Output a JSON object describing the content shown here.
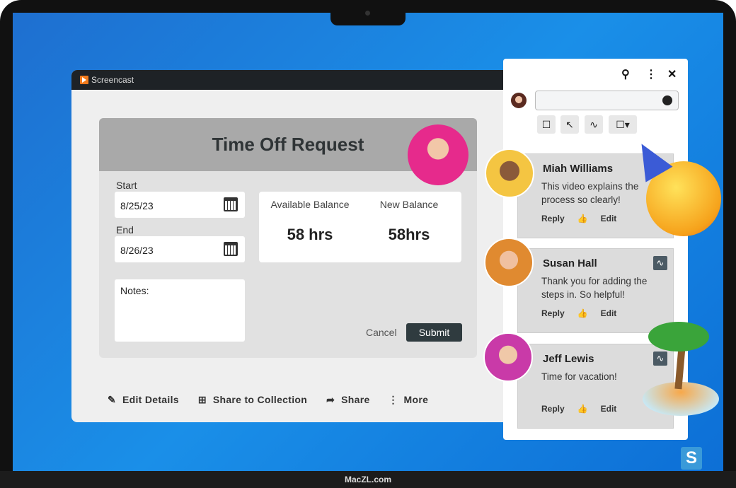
{
  "app": {
    "title": "Screencast"
  },
  "form": {
    "title": "Time Off Request",
    "start_label": "Start",
    "start_value": "8/25/23",
    "end_label": "End",
    "end_value": "8/26/23",
    "notes_label": "Notes:",
    "available_label": "Available Balance",
    "available_value": "58 hrs",
    "new_label": "New Balance",
    "new_value": "58hrs",
    "cancel": "Cancel",
    "submit": "Submit"
  },
  "actions": [
    {
      "label": "Edit Details",
      "icon": "pencil-icon"
    },
    {
      "label": "Share to Collection",
      "icon": "collection-icon"
    },
    {
      "label": "Share",
      "icon": "share-icon"
    },
    {
      "label": "More",
      "icon": "more-icon"
    }
  ],
  "comments": [
    {
      "name": "Miah Williams",
      "text": "This video explains the process so clearly!",
      "reply": "Reply",
      "edit": "Edit",
      "avatar_color": "#f4c542"
    },
    {
      "name": "Susan Hall",
      "text": "Thank you for adding the steps in. So helpful!",
      "reply": "Reply",
      "edit": "Edit",
      "avatar_color": "#f0a030"
    },
    {
      "name": "Jeff Lewis",
      "text": "Time for vacation!",
      "reply": "Reply",
      "edit": "Edit",
      "avatar_color": "#c93aa8"
    }
  ],
  "footer": "MacZL.com",
  "brand_letter": "S"
}
